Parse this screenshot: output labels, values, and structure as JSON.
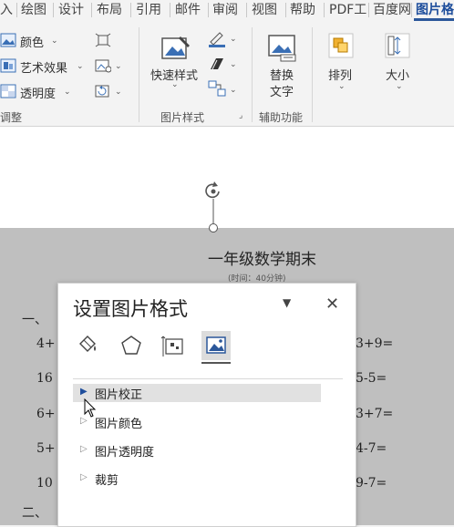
{
  "tabs": [
    {
      "label": "入"
    },
    {
      "label": "绘图"
    },
    {
      "label": "设计"
    },
    {
      "label": "布局"
    },
    {
      "label": "引用"
    },
    {
      "label": "邮件"
    },
    {
      "label": "审阅"
    },
    {
      "label": "视图"
    },
    {
      "label": "帮助"
    },
    {
      "label": "PDF工"
    },
    {
      "label": "百度网"
    },
    {
      "label": "图片格"
    }
  ],
  "ribbon": {
    "adjust": {
      "color": "颜色",
      "artistic": "艺术效果",
      "transparency": "透明度",
      "group_label": "调整"
    },
    "styles": {
      "quick_styles": "快速样式",
      "group_label": "图片样式"
    },
    "accessibility": {
      "alt_text_line1": "替换",
      "alt_text_line2": "文字",
      "group_label": "辅助功能"
    },
    "arrange": {
      "label": "排列"
    },
    "size": {
      "label": "大小"
    }
  },
  "document": {
    "title": "一年级数学期末",
    "subtitle": "(时间：40分钟)",
    "section_one": "一、",
    "section_two": "二、",
    "left_column": [
      "4+",
      "16",
      "6+",
      "5+",
      "10"
    ],
    "right_column": [
      "3+9=",
      "5-5=",
      "3+7=",
      "4-7=",
      "9-7="
    ]
  },
  "format_pane": {
    "title": "设置图片格式",
    "dropdown_glyph": "▼",
    "close_glyph": "✕",
    "sections": [
      {
        "label": "图片校正",
        "expanded_glyph": "▶"
      },
      {
        "label": "图片颜色",
        "expanded_glyph": "▷"
      },
      {
        "label": "图片透明度",
        "expanded_glyph": "▷"
      },
      {
        "label": "裁剪",
        "expanded_glyph": "▷"
      }
    ]
  },
  "colors": {
    "accent": "#2b579a",
    "ribbon_bg": "#f3f3f3",
    "doc_gray": "#bfbfbf"
  }
}
